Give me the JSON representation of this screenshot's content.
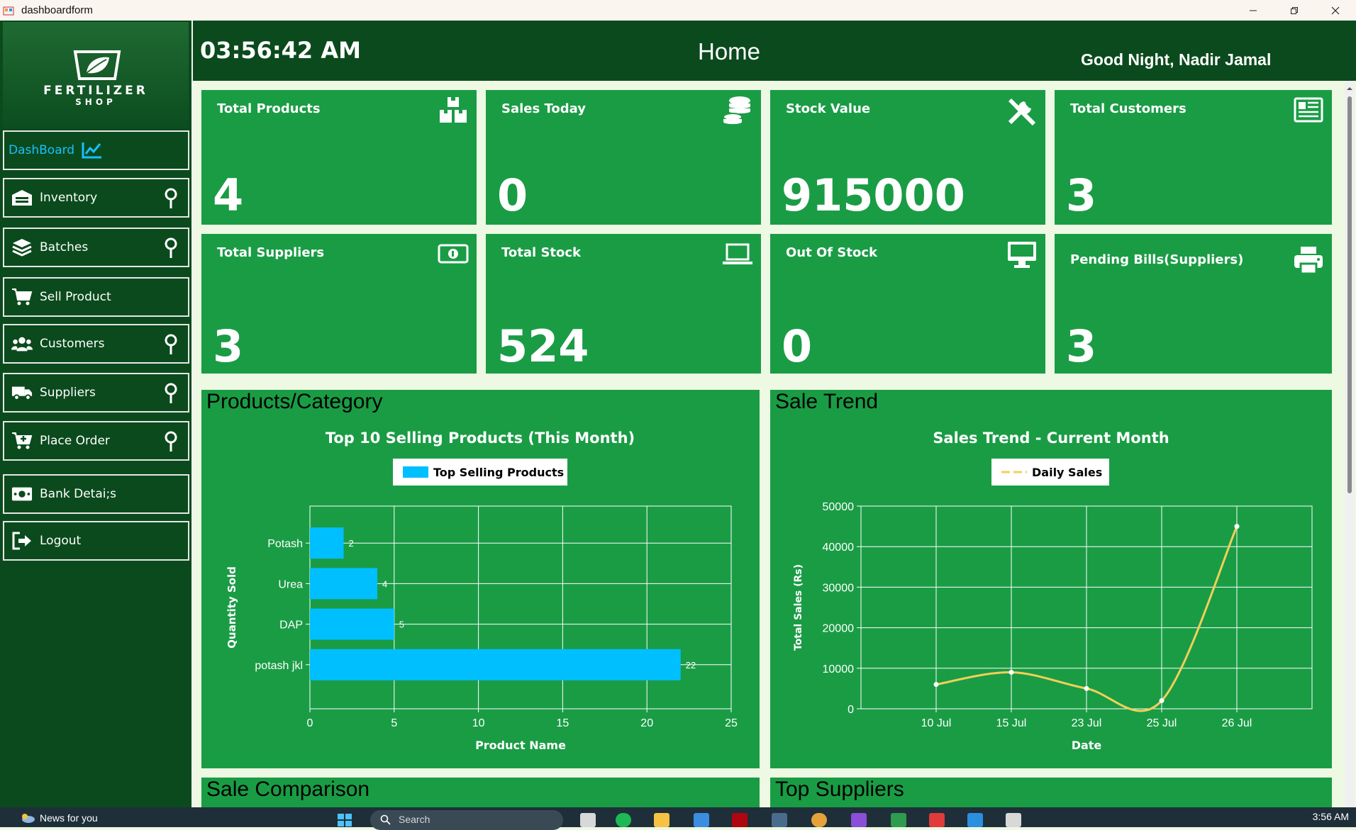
{
  "window": {
    "title": "dashboardform"
  },
  "sidebar": {
    "logo": {
      "title": "FERTILIZER",
      "subtitle": "SHOP"
    },
    "items": [
      {
        "label": "DashBoard"
      },
      {
        "label": "Inventory"
      },
      {
        "label": "Batches"
      },
      {
        "label": "Sell Product"
      },
      {
        "label": "Customers"
      },
      {
        "label": "Suppliers"
      },
      {
        "label": "Place Order"
      },
      {
        "label": "Bank Detai;s"
      },
      {
        "label": "Logout"
      }
    ]
  },
  "header": {
    "time": "03:56:42 AM",
    "title": "Home",
    "greeting": "Good Night, Nadir Jamal"
  },
  "cards": [
    {
      "title": "Total Products",
      "value": "4",
      "icon": "boxes-icon"
    },
    {
      "title": "Sales Today",
      "value": "0",
      "icon": "coins-icon"
    },
    {
      "title": "Stock Value",
      "value": "915000",
      "icon": "tools-icon"
    },
    {
      "title": "Total Customers",
      "value": "3",
      "icon": "newspaper-icon"
    },
    {
      "title": "Total Suppliers",
      "value": "3",
      "icon": "money-bill-icon"
    },
    {
      "title": "Total Stock",
      "value": "524",
      "icon": "laptop-icon"
    },
    {
      "title": "Out Of Stock",
      "value": "0",
      "icon": "monitor-icon"
    },
    {
      "title": "Pending Bills(Suppliers)",
      "value": "3",
      "icon": "printer-icon"
    }
  ],
  "panels": {
    "products_category": "Products/Category",
    "sale_trend": "Sale Trend",
    "sale_comparison": "Sale Comparison",
    "top_suppliers": "Top Suppliers"
  },
  "chart_data": [
    {
      "type": "bar",
      "orientation": "horizontal",
      "title": "Top 10 Selling Products (This Month)",
      "xlabel": "Product Name",
      "ylabel": "Quantity Sold",
      "categories": [
        "Potash",
        "Urea",
        "DAP",
        "potash jkl"
      ],
      "series": [
        {
          "name": "Top Selling Products",
          "values": [
            2,
            4,
            5,
            22
          ]
        }
      ],
      "xlim": [
        0,
        25
      ],
      "xticks": [
        0,
        5,
        10,
        15,
        20,
        25
      ],
      "grid": true,
      "legend": "top",
      "color": "#00bfff"
    },
    {
      "type": "line",
      "title": "Sales Trend - Current Month",
      "xlabel": "Date",
      "ylabel": "Total Sales (Rs)",
      "categories": [
        "10 Jul",
        "15 Jul",
        "23 Jul",
        "25 Jul",
        "26 Jul"
      ],
      "series": [
        {
          "name": "Daily Sales",
          "values": [
            6000,
            9000,
            5000,
            2000,
            45000
          ]
        }
      ],
      "ylim": [
        0,
        50000
      ],
      "yticks": [
        0,
        10000,
        20000,
        30000,
        40000,
        50000
      ],
      "grid": true,
      "legend": "top",
      "color": "#f2d05a"
    }
  ],
  "taskbar": {
    "news": "News for you",
    "search": "Search",
    "clock": "3:56 AM"
  },
  "colors": {
    "sidebar": "#0b4a1d",
    "card": "#1a9c45",
    "bar": "#00bfff",
    "line": "#f2d05a",
    "active": "#18c0ff"
  }
}
